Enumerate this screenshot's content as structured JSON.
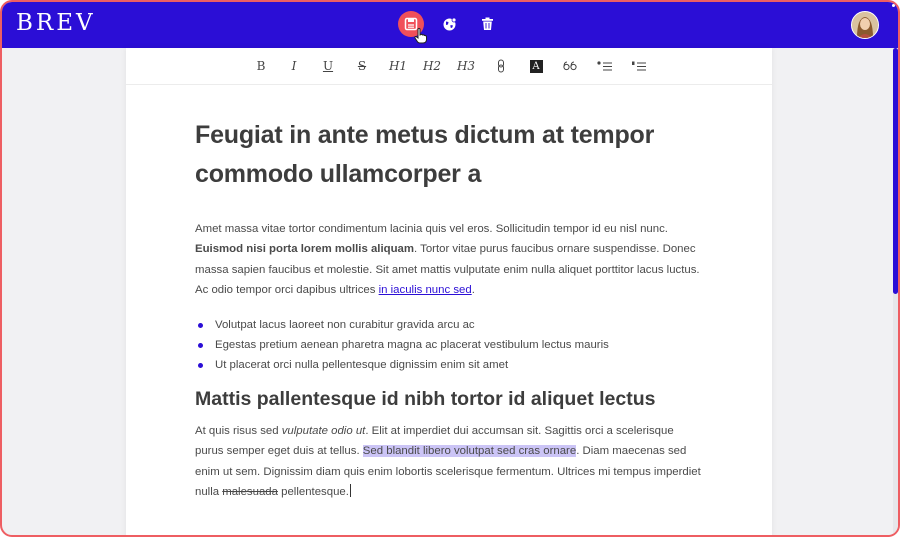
{
  "app": {
    "logo": "BREV"
  },
  "topbar": {
    "actions": [
      {
        "name": "save",
        "icon": "save-icon"
      },
      {
        "name": "publish",
        "icon": "globe-icon"
      },
      {
        "name": "delete",
        "icon": "trash-icon"
      }
    ],
    "accent_color": "#2b0ed6",
    "save_color": "#f0505a"
  },
  "format_toolbar": {
    "bold": "B",
    "italic": "I",
    "underline": "U",
    "strike": "S",
    "h1": "H1",
    "h2": "H2",
    "h3": "H3",
    "link_icon": "link-icon",
    "highlight": "A",
    "quote_icon": "quote-icon",
    "bullet_list_icon": "bulleted-list-icon",
    "numbered_list_icon": "numbered-list-icon"
  },
  "document": {
    "title": "Feugiat in ante metus dictum at tempor commodo ullamcorper a",
    "para1": {
      "text1": "Amet massa vitae tortor condimentum lacinia quis vel eros. Sollicitudin tempor id eu nisl nunc. ",
      "bold": "Euismod nisi porta lorem mollis aliquam",
      "text2": ". Tortor vitae purus faucibus ornare suspendisse. Donec massa sapien faucibus et molestie. Sit amet mattis vulputate enim nulla aliquet porttitor lacus luctus. Ac odio tempor orci dapibus ultrices ",
      "link": "in iaculis nunc sed",
      "text3": "."
    },
    "bullets": [
      "Volutpat lacus laoreet non curabitur gravida arcu ac",
      "Egestas pretium aenean pharetra magna ac placerat vestibulum lectus mauris",
      "Ut placerat orci nulla pellentesque dignissim enim sit amet"
    ],
    "subtitle": "Mattis pallentesque id nibh tortor id aliquet lectus",
    "para2": {
      "text1": "At quis risus sed ",
      "italic": "vulputate odio ut",
      "text2": ". Elit at imperdiet dui accumsan sit. Sagittis orci a scelerisque purus semper eget duis at tellus. ",
      "selected": "Sed blandit libero volutpat sed cras ornare",
      "text3": ". Diam maecenas sed enim ut sem. Dignissim diam quis enim lobortis scelerisque fermentum. Ultrices mi tempus imperdiet nulla ",
      "strikethrough": "malesuada",
      "text4": " pellentesque."
    }
  }
}
